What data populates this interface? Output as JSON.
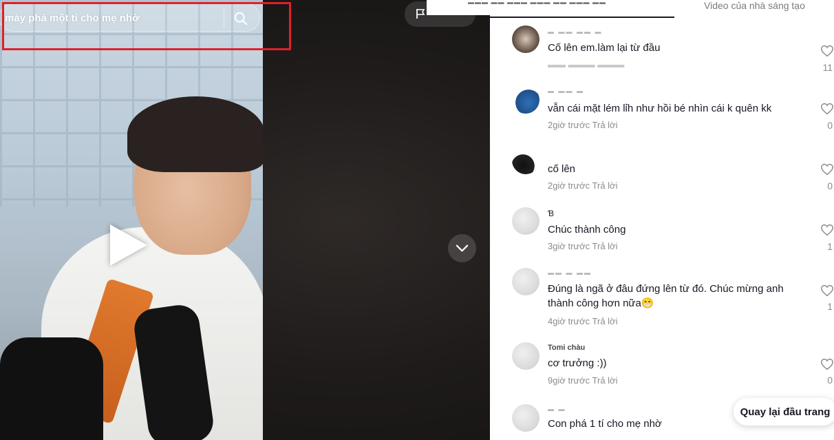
{
  "search": {
    "query": "mày phá một tí cho mẹ nhờ"
  },
  "tabs": {
    "creator_videos": "Video của nhà sáng tạo"
  },
  "comments": [
    {
      "text": "Cố lên em.làm lại từ đầu",
      "meta": "",
      "likes": "11"
    },
    {
      "text": "vẫn cái mặt lém lỉh như hồi bé nhìn cái k quên kk",
      "meta": "2giờ trước Trả lời",
      "likes": "0"
    },
    {
      "text": "cố lên",
      "meta": "2giờ trước Trả lời",
      "likes": "0"
    },
    {
      "username": "Ɓ",
      "text": "Chúc thành công",
      "meta": "3giờ trước Trả lời",
      "likes": "1"
    },
    {
      "text": "Đúng là ngã ở đâu đứng lên từ đó. Chúc mừng anh thành công hơn nữa😁",
      "meta": "4giờ trước Trả lời",
      "likes": "1"
    },
    {
      "username": "Tomi chàu",
      "text": "cơ trưởng :))",
      "meta": "9giờ trước Trả lời",
      "likes": "0"
    },
    {
      "text": "Con phá 1 tí cho mẹ nhờ",
      "meta": "",
      "likes": ""
    }
  ],
  "back_to_top": "Quay lại đầu trang",
  "icons": {
    "search": "search-icon",
    "flag": "flag-icon",
    "down": "chevron-down-icon",
    "play": "play-icon",
    "heart": "heart-icon"
  },
  "colors": {
    "highlight": "#e0202a",
    "text": "#161823",
    "muted": "#8a8b91"
  }
}
